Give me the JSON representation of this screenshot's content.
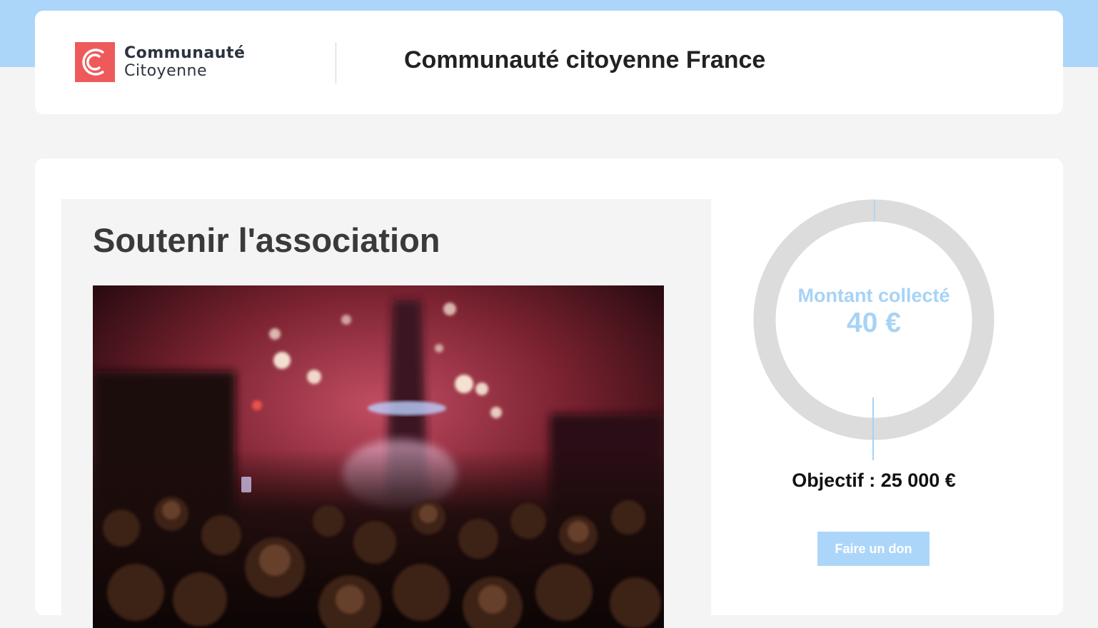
{
  "header": {
    "logo": {
      "line1": "Communauté",
      "line2": "Citoyenne",
      "brand_color": "#ee5a5a"
    },
    "site_title": "Communauté citoyenne France"
  },
  "main": {
    "section_title": "Soutenir l'association",
    "hero_image_alt": "Foule devant un feu d'artifice",
    "fundraising": {
      "label": "Montant collecté",
      "amount": "40 €",
      "collected_value": 40,
      "goal_value": 25000,
      "goal_text": "Objectif : 25 000 €",
      "donate_label": "Faire un don",
      "accent_color": "#a7d3f5",
      "track_color": "#dcdcdc"
    }
  },
  "colors": {
    "top_band": "#acd6f9",
    "page_background": "#f4f4f4",
    "button": "#acd6f9"
  }
}
